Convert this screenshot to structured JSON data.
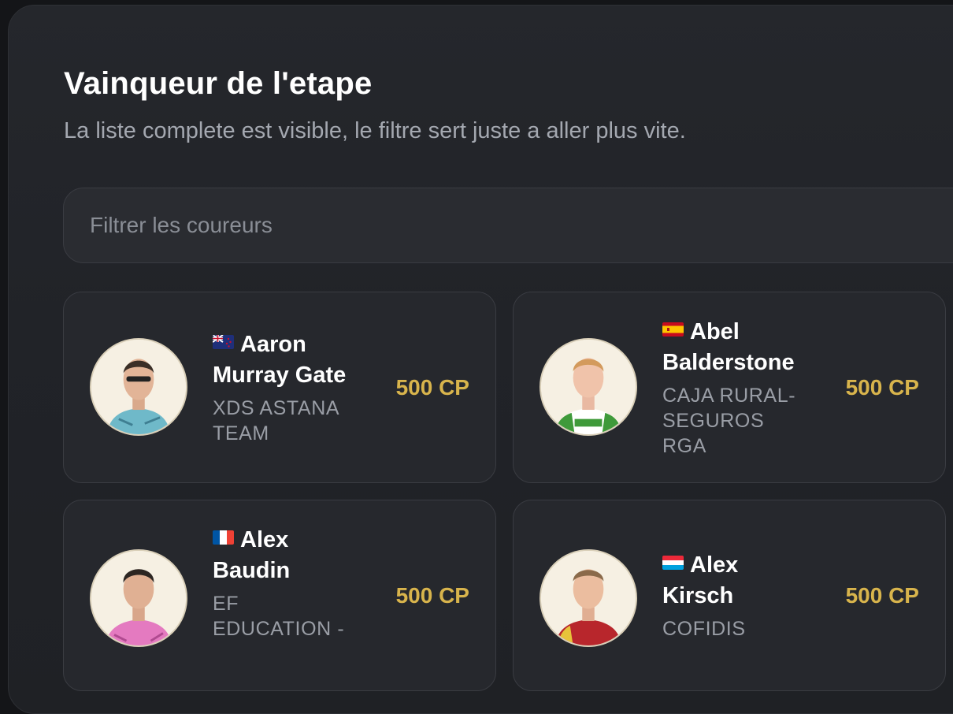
{
  "header": {
    "title": "Vainqueur de l'etape",
    "subtitle": "La liste complete est visible, le filtre sert juste a aller plus vite."
  },
  "filter": {
    "placeholder": "Filtrer les coureurs",
    "value": ""
  },
  "riders": [
    {
      "first_name": "Aaron",
      "last_name": "Murray Gate",
      "team": "XDS ASTANA TEAM",
      "price": "500 CP",
      "flag_icon": "new-zealand-flag-icon",
      "jersey_color": "#6fb9c9"
    },
    {
      "first_name": "Abel",
      "last_name": "Balderstone",
      "team": "CAJA RURAL-SEGUROS RGA",
      "price": "500 CP",
      "flag_icon": "spain-flag-icon",
      "jersey_color": "#3f9a3a"
    },
    {
      "first_name": "Alex",
      "last_name": "Baudin",
      "team": "EF EDUCATION -",
      "price": "500 CP",
      "flag_icon": "france-flag-icon",
      "jersey_color": "#e47ac0"
    },
    {
      "first_name": "Alex",
      "last_name": "Kirsch",
      "team": "COFIDIS",
      "price": "500 CP",
      "flag_icon": "luxembourg-flag-icon",
      "jersey_color": "#b8262c"
    }
  ],
  "colors": {
    "accent_price": "#d8b44c",
    "background": "#141518",
    "panel": "#212328"
  }
}
